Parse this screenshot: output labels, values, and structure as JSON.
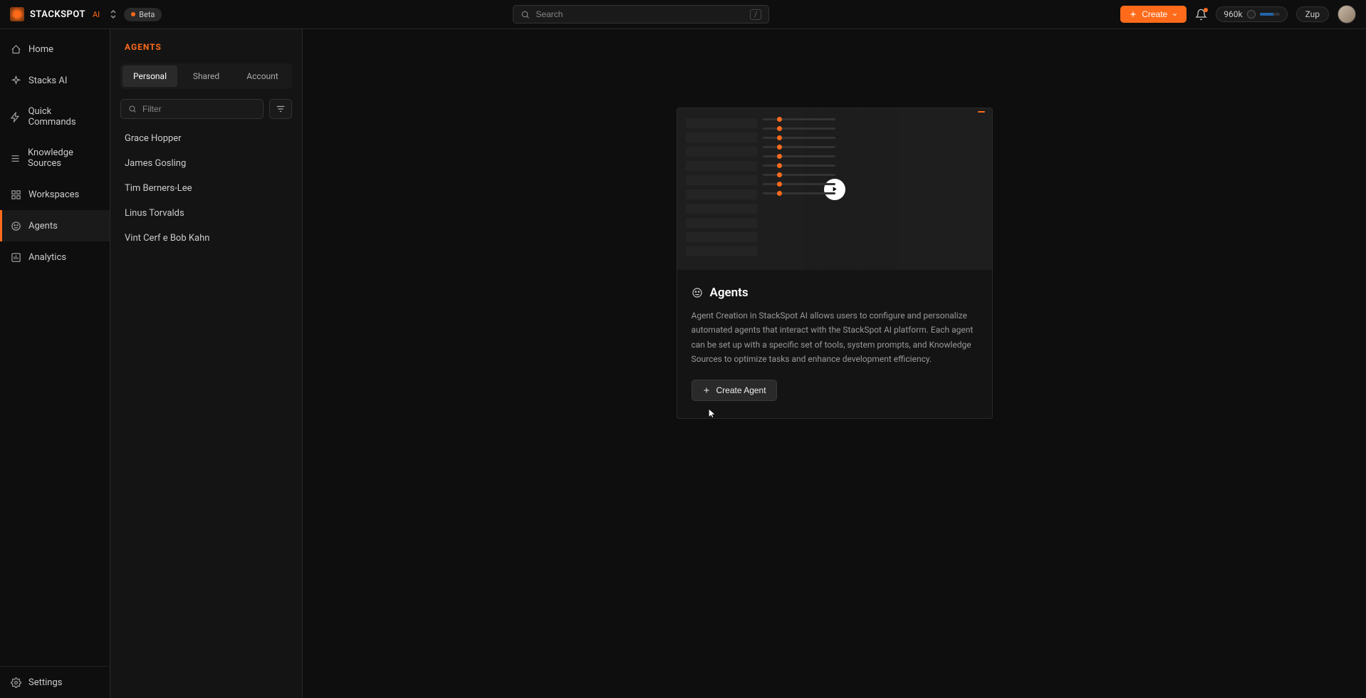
{
  "header": {
    "brand": "STACKSPOT",
    "brand_suffix": "AI",
    "beta_label": "Beta",
    "search_placeholder": "Search",
    "search_hint": "/",
    "create_label": "Create",
    "credits": "960k",
    "org_label": "Zup"
  },
  "sidebar": {
    "items": [
      {
        "label": "Home",
        "icon": "home-icon"
      },
      {
        "label": "Stacks AI",
        "icon": "sparkle-icon"
      },
      {
        "label": "Quick Commands",
        "icon": "bolt-icon"
      },
      {
        "label": "Knowledge Sources",
        "icon": "stack-icon"
      },
      {
        "label": "Workspaces",
        "icon": "grid-icon"
      },
      {
        "label": "Agents",
        "icon": "face-icon",
        "active": true
      },
      {
        "label": "Analytics",
        "icon": "chart-icon"
      }
    ],
    "footer": {
      "label": "Settings",
      "icon": "gear-icon"
    }
  },
  "panel": {
    "title": "AGENTS",
    "tabs": [
      {
        "label": "Personal",
        "active": true
      },
      {
        "label": "Shared"
      },
      {
        "label": "Account"
      }
    ],
    "filter_placeholder": "Filter",
    "agents": [
      "Grace Hopper",
      "James Gosling",
      "Tim Berners-Lee",
      "Linus Torvalds",
      "Vint Cerf e Bob Kahn"
    ]
  },
  "card": {
    "title": "Agents",
    "description": "Agent Creation in StackSpot AI allows users to configure and personalize automated agents that interact with the StackSpot AI platform. Each agent can be set up with a specific set of tools, system prompts, and Knowledge Sources to optimize tasks and enhance development efficiency.",
    "button_label": "Create Agent"
  }
}
